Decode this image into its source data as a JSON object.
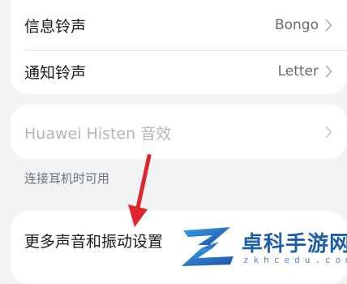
{
  "sound_settings": {
    "message_ringtone": {
      "label": "信息铃声",
      "value": "Bongo"
    },
    "notification_ringtone": {
      "label": "通知铃声",
      "value": "Letter"
    },
    "histen": {
      "label": "Huawei Histen 音效",
      "enabled": false
    },
    "histen_caption": "连接耳机时可用",
    "more_settings": {
      "label": "更多声音和振动设置"
    }
  },
  "annotation": {
    "arrow_color": "#e0262b"
  },
  "watermark": {
    "brand": "卓科手游网",
    "url": "zkhcedu.com",
    "color": "#1f5ea8"
  }
}
